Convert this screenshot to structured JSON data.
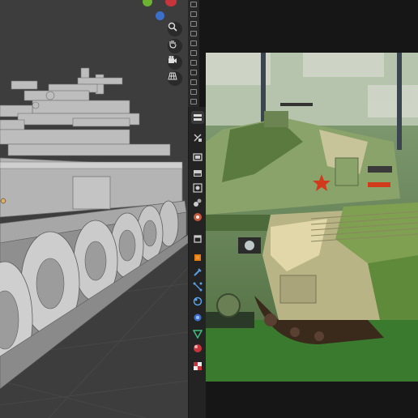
{
  "app": "Blender",
  "viewport": {
    "background_color": "#3d3d3d",
    "nav_buttons": [
      "zoom-icon",
      "hand-pan-icon",
      "camera-icon",
      "grid-ortho-icon"
    ]
  },
  "gizmo": {
    "y_color": "#6bb42f",
    "z_color": "#3b6fc8",
    "x_color": "#c8343c"
  },
  "outliner": {
    "camera_icon_count": 11
  },
  "properties_tabs": [
    "tool-icon",
    "render-icon",
    "output-icon",
    "view-layer-icon",
    "scene-icon",
    "world-icon",
    "collection-icon",
    "object-icon",
    "modifier-icon",
    "particles-icon",
    "physics-icon",
    "constraints-icon",
    "data-icon",
    "material-icon",
    "texture-icon"
  ],
  "accent": "#e87d0d",
  "reference_photo": {
    "subject": "tank-reference-photo",
    "emblem_color": "#d23a1c"
  }
}
